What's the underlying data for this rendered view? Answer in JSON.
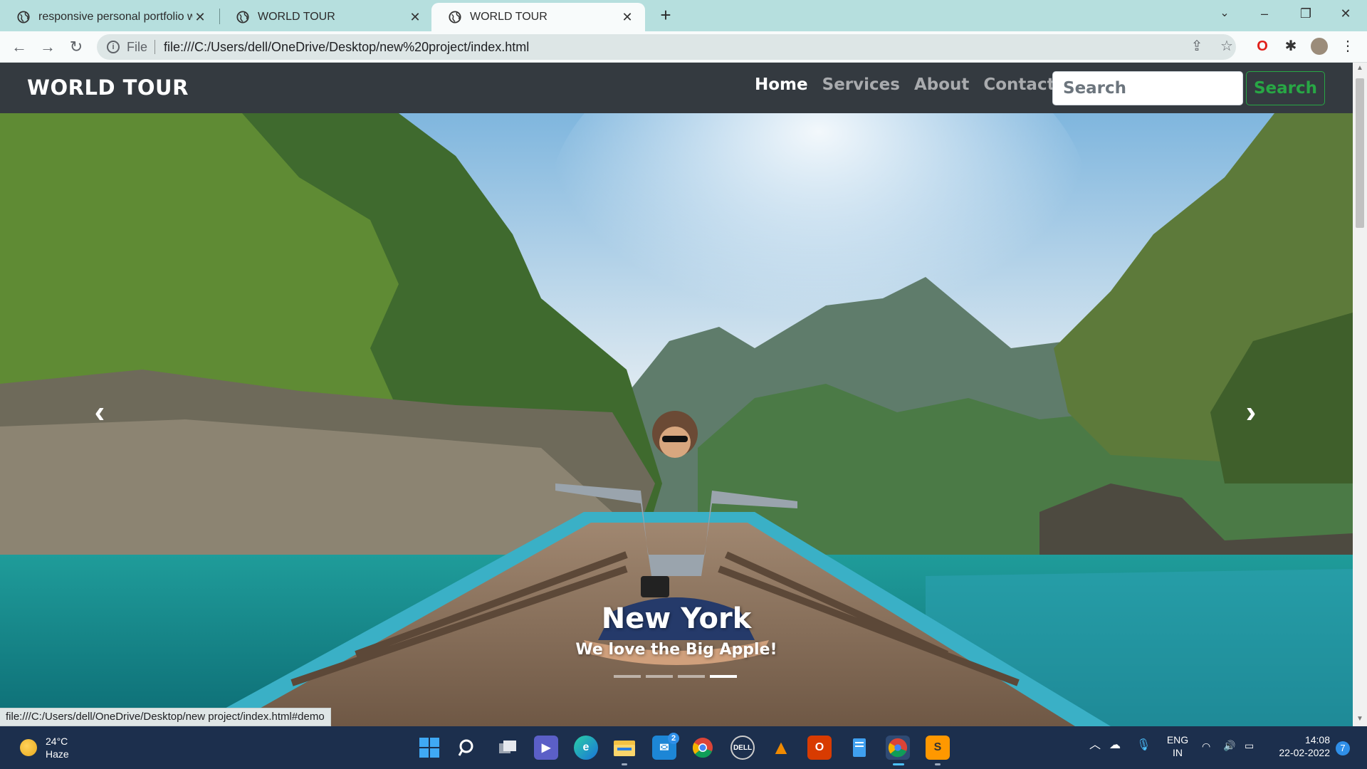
{
  "browser": {
    "tabs": [
      {
        "title": "responsive personal portfolio we",
        "active": false
      },
      {
        "title": "WORLD TOUR",
        "active": false
      },
      {
        "title": "WORLD TOUR",
        "active": true
      }
    ],
    "new_tab": "+",
    "address": {
      "scheme": "File",
      "url": "file:///C:/Users/dell/OneDrive/Desktop/new%20project/index.html"
    },
    "status_url": "file:///C:/Users/dell/OneDrive/Desktop/new project/index.html#demo"
  },
  "navbar": {
    "brand": "WORLD TOUR",
    "links": [
      {
        "label": "Home",
        "active": true
      },
      {
        "label": "Services",
        "active": false
      },
      {
        "label": "About",
        "active": false
      },
      {
        "label": "Contacts",
        "active": false
      }
    ],
    "search_placeholder": "Search",
    "search_button": "Search"
  },
  "carousel": {
    "caption_title": "New York",
    "caption_text": "We love the Big Apple!",
    "slide_count": 4,
    "active_index": 3,
    "prev_icon": "chevron-left-icon",
    "next_icon": "chevron-right-icon"
  },
  "taskbar": {
    "weather": {
      "temp": "24°C",
      "condition": "Haze"
    },
    "language": {
      "line1": "ENG",
      "line2": "IN"
    },
    "time": "14:08",
    "date": "22-02-2022",
    "notifications": "7",
    "mail_badge": "2"
  },
  "colors": {
    "tabstrip": "#b6dfde",
    "navbar": "#343a40",
    "search_green": "#28a745",
    "taskbar": "#1c2f4d"
  }
}
